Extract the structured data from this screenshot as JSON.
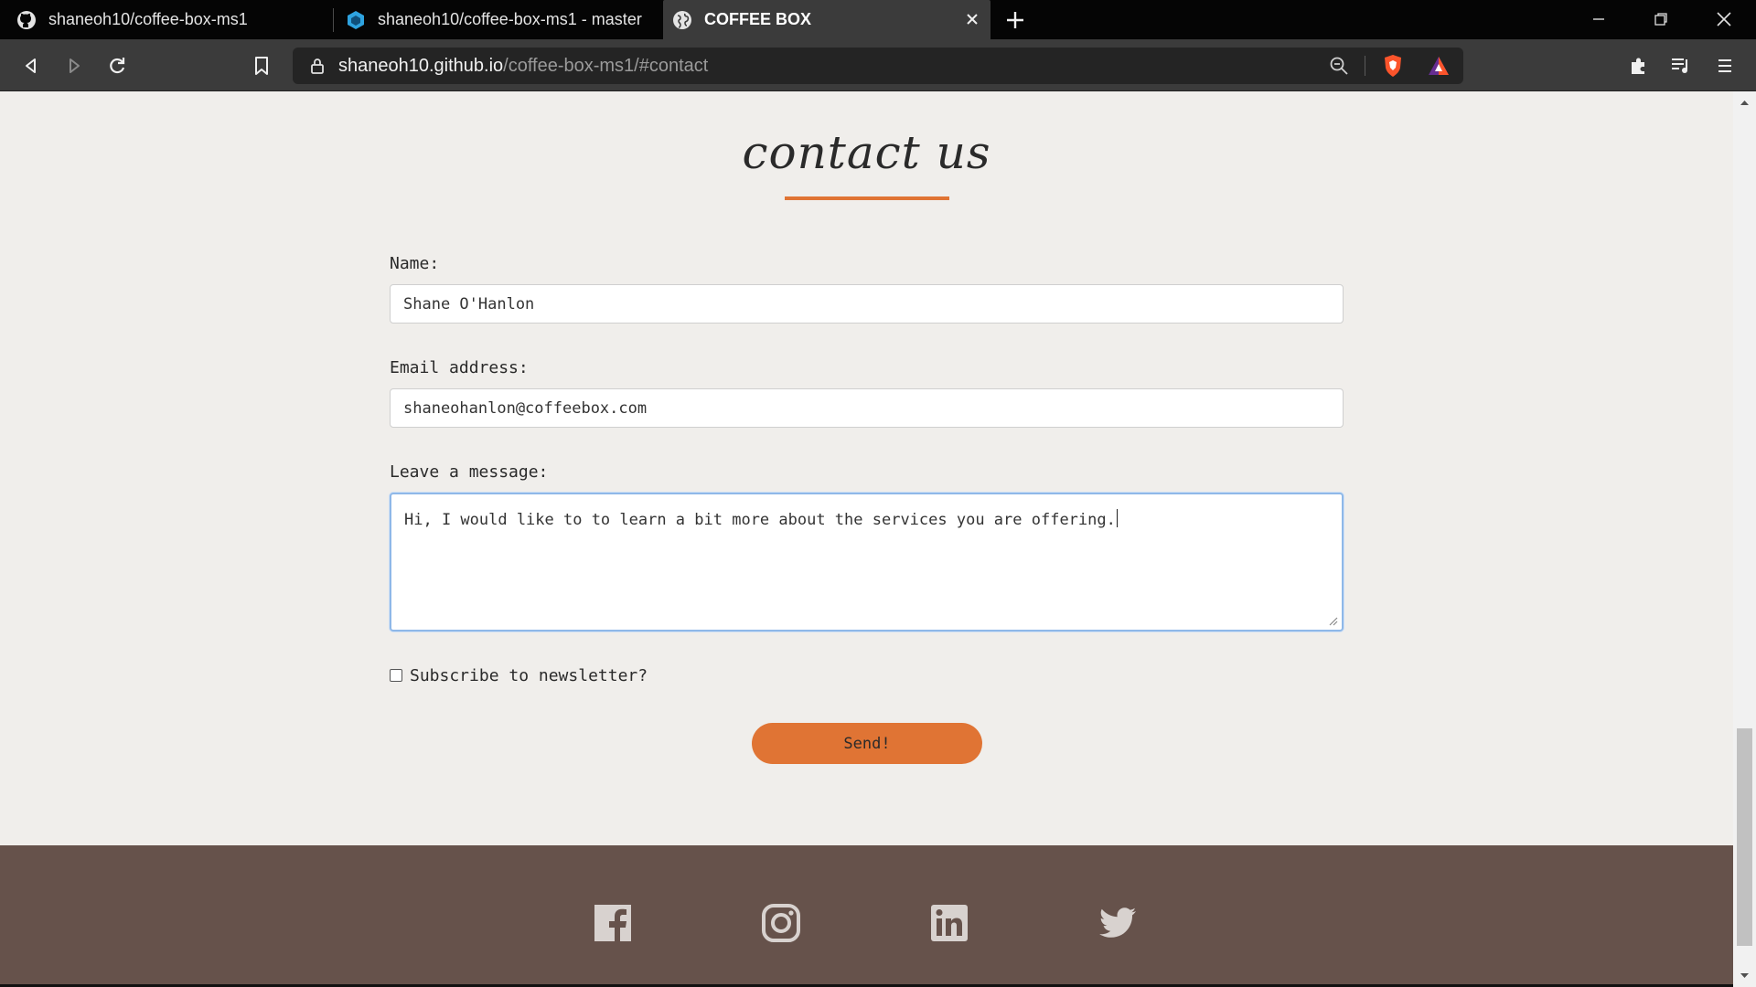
{
  "tabs": [
    {
      "title": "shaneoh10/coffee-box-ms1",
      "icon": "github-icon"
    },
    {
      "title": "shaneoh10/coffee-box-ms1 - master",
      "icon": "cube-icon"
    },
    {
      "title": "COFFEE BOX",
      "icon": "globe-icon",
      "active": true
    }
  ],
  "address_bar": {
    "host": "shaneoh10.github.io",
    "path": "/coffee-box-ms1/#contact"
  },
  "contact": {
    "heading": "contact us",
    "name_label": "Name:",
    "name_value": "Shane O'Hanlon",
    "email_label": "Email address:",
    "email_value": "shaneohanlon@coffeebox.com",
    "message_label": "Leave a message:",
    "message_value": "Hi, I would like to to learn a bit more about the services you are offering.",
    "newsletter_label": "Subscribe to newsletter?",
    "newsletter_checked": false,
    "send_label": "Send!"
  },
  "footer": {
    "social_icons": [
      "facebook-icon",
      "instagram-icon",
      "linkedin-icon",
      "twitter-icon"
    ]
  },
  "colors": {
    "accent": "#e07434",
    "page_bg": "#f0eeeb",
    "footer_bg": "#66524b",
    "chrome_bg": "#3b3b3b"
  }
}
